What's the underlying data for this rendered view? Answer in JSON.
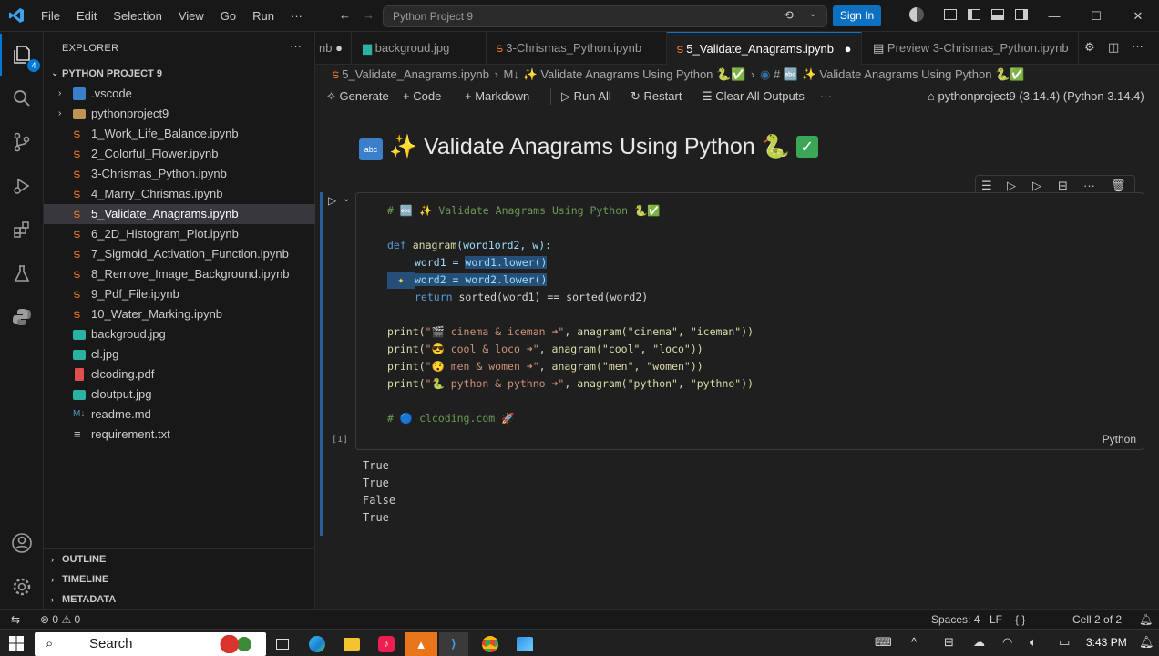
{
  "menu": [
    "File",
    "Edit",
    "Selection",
    "View",
    "Go",
    "Run",
    "···"
  ],
  "command_center": "Python Project 9",
  "signin": "Sign In",
  "explorer": {
    "title": "EXPLORER",
    "project": "PYTHON PROJECT 9",
    "items": [
      ".vscode",
      "pythonproject9",
      "1_Work_Life_Balance.ipynb",
      "2_Colorful_Flower.ipynb",
      "3-Chrismas_Python.ipynb",
      "4_Marry_Chrismas.ipynb",
      "5_Validate_Anagrams.ipynb",
      "6_2D_Histogram_Plot.ipynb",
      "7_Sigmoid_Activation_Function.ipynb",
      "8_Remove_Image_Background.ipynb",
      "9_Pdf_File.ipynb",
      "10_Water_Marking.ipynb",
      "backgroud.jpg",
      "cl.jpg",
      "clcoding.pdf",
      "cloutput.jpg",
      "readme.md",
      "requirement.txt"
    ],
    "sections": [
      "OUTLINE",
      "TIMELINE",
      "METADATA"
    ]
  },
  "tabs": [
    "nb",
    "backgroud.jpg",
    "3-Chrismas_Python.ipynb",
    "5_Validate_Anagrams.ipynb",
    "Preview 3-Chrismas_Python.ipynb"
  ],
  "breadcrumb": {
    "file": "5_Validate_Anagrams.ipynb",
    "md_marker": "M↓",
    "heading": "✨ Validate Anagrams Using Python 🐍✅",
    "code_sep": "# 🔤 ✨ Validate Anagrams Using Python 🐍✅"
  },
  "toolbar": {
    "generate": "Generate",
    "code": "Code",
    "markdown": "Markdown",
    "run_all": "Run All",
    "restart": "Restart",
    "clear": "Clear All Outputs",
    "more": "···",
    "kernel": "pythonproject9 (3.14.4) (Python 3.14.4)"
  },
  "heading": "Validate Anagrams Using Python",
  "code": {
    "line1": "# 🔤 ✨ Validate Anagrams Using Python 🐍✅",
    "def_kw": "def",
    "fn_name": "anagram",
    "params": "(word1ord2, w):",
    "l3a": "word1 = ",
    "l3b": "word1.lower()",
    "l4": "word2 = word2.lower()",
    "l5_kw": "return",
    "l5_rest": " sorted(word1) == sorted(word2)",
    "p1_str": "\"🎬 cinema & iceman ➜\"",
    "p1_call": "anagram(\"cinema\", \"iceman\"))",
    "p2_str": "\"😎 cool & loco ➜\"",
    "p2_call": "anagram(\"cool\", \"loco\"))",
    "p3_str": "\"😯 men & women ➜\"",
    "p3_call": "anagram(\"men\", \"women\"))",
    "p4_str": "\"🐍 python & pythno ➜\"",
    "p4_call": "anagram(\"python\", \"pythno\"))",
    "print": "print(",
    "comment": "# 🔵 clcoding.com 🚀",
    "exec_count": "[1]",
    "language": "Python"
  },
  "output": [
    "True",
    "True",
    "False",
    "True"
  ],
  "status": {
    "errors": "0",
    "warnings": "0",
    "spaces": "Spaces: 4",
    "eol": "LF",
    "braces": "{ }",
    "cell": "Cell 2 of 2"
  },
  "taskbar": {
    "search": "Search",
    "time": "3:43 PM"
  },
  "colors": {
    "accent": "#0078d4",
    "signin": "#0e70c0"
  }
}
